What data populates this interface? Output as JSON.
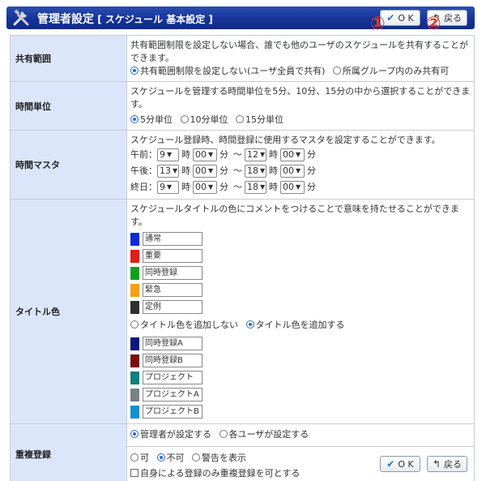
{
  "header": {
    "title": "管理者設定",
    "subtitle": "[ スケジュール  基本設定 ]",
    "ok_label": "O K",
    "back_label": "戻る",
    "marker1": "①",
    "marker2": "②"
  },
  "share": {
    "label": "共有範囲",
    "desc": "共有範囲制限を設定しない場合、誰でも他のユーザのスケジュールを共有することができます。",
    "opt1": "共有範囲制限を設定しない(ユーザ全員で共有)",
    "opt2": "所属グループ内のみ共有可",
    "selected": 0
  },
  "unit": {
    "label": "時間単位",
    "desc": "スケジュールを管理する時間単位を5分、10分、15分の中から選択することができます。",
    "opt1": "5分単位",
    "opt2": "10分単位",
    "opt3": "15分単位",
    "selected": 0
  },
  "master": {
    "label": "時間マスタ",
    "desc": "スケジュール登録時、時間登録に使用するマスタを設定することができます。",
    "hour_label": "時",
    "min_label": "分",
    "tilde": "～",
    "rows": [
      {
        "name": "午前：",
        "sh": "9",
        "sm": "00",
        "eh": "12",
        "em": "00"
      },
      {
        "name": "午後：",
        "sh": "13",
        "sm": "00",
        "eh": "18",
        "em": "00"
      },
      {
        "name": "終日：",
        "sh": "9",
        "sm": "00",
        "eh": "18",
        "em": "00"
      }
    ]
  },
  "title_color": {
    "label": "タイトル色",
    "desc": "スケジュールタイトルの色にコメントをつけることで意味を持たせることができます。",
    "base": [
      {
        "color": "#0a2bd8",
        "text": "通常"
      },
      {
        "color": "#e02010",
        "text": "重要"
      },
      {
        "color": "#10a020",
        "text": "同時登録"
      },
      {
        "color": "#f5a010",
        "text": "緊急"
      },
      {
        "color": "#303030",
        "text": "定例"
      }
    ],
    "opt1": "タイトル色を追加しない",
    "opt2": "タイトル色を追加する",
    "selected": 1,
    "extra": [
      {
        "color": "#0a1878",
        "text": "同時登録A"
      },
      {
        "color": "#7a1010",
        "text": "同時登録B"
      },
      {
        "color": "#108080",
        "text": "プロジェクト"
      },
      {
        "color": "#7a8088",
        "text": "プロジェクトA"
      },
      {
        "color": "#1090d0",
        "text": "プロジェクトB"
      }
    ]
  },
  "dup": {
    "label": "重複登録",
    "who_opt1": "管理者が設定する",
    "who_opt2": "各ユーザが設定する",
    "who_selected": 0,
    "opt1": "可",
    "opt2": "不可",
    "opt3": "警告を表示",
    "selected": 1,
    "check_label": "自身による登録のみ重複登録を可とする"
  },
  "footer": {
    "ok_label": "O K",
    "back_label": "戻る"
  }
}
